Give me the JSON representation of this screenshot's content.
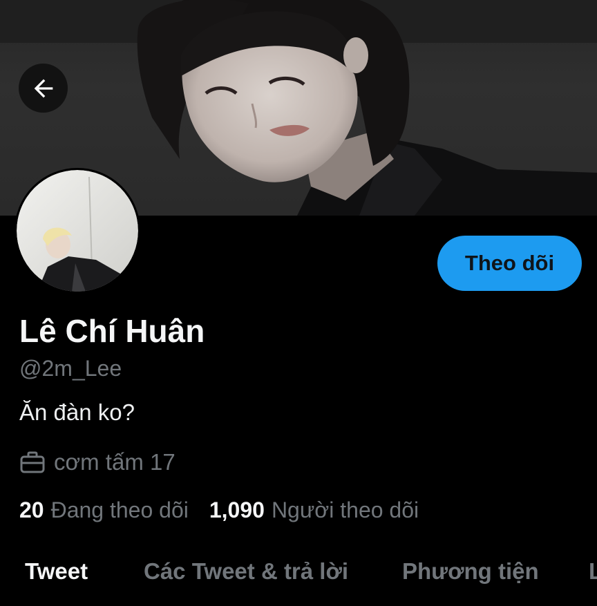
{
  "header": {
    "back_icon": "arrow-left-icon"
  },
  "profile": {
    "display_name": "Lê Chí Huân",
    "handle": "@2m_Lee",
    "bio": "Ăn đàn ko?",
    "work": {
      "icon": "briefcase-icon",
      "text": "cơm tấm 17"
    },
    "follow_button_label": "Theo dõi",
    "follow_button_color": "#1d9bf0"
  },
  "stats": {
    "following_count": "20",
    "following_label": "Đang theo dõi",
    "followers_count": "1,090",
    "followers_label": "Người theo dõi"
  },
  "tabs": [
    {
      "label": "Tweet",
      "active": true
    },
    {
      "label": "Các Tweet & trả lời",
      "active": false
    },
    {
      "label": "Phương tiện",
      "active": false
    },
    {
      "label": "L",
      "active": false
    }
  ]
}
